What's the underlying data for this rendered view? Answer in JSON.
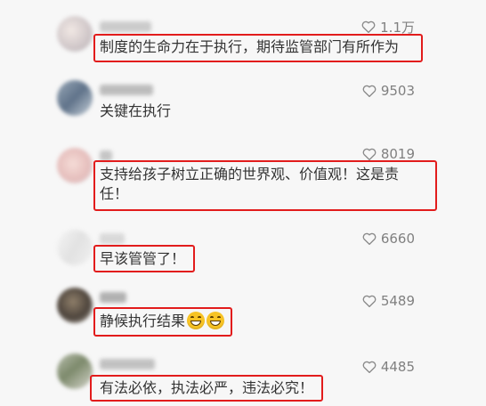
{
  "comments": [
    {
      "text": "制度的生命力在于执行，期待监管部门有所作为",
      "likes": "1.1万",
      "username": "jiasong"
    },
    {
      "text": "关键在执行",
      "likes": "9503",
      "username": ""
    },
    {
      "text_line1": "支持给孩子树立正确的世界观、价值观！这是责",
      "text_line2": "任！",
      "likes": "8019",
      "username": ""
    },
    {
      "text": "早该管管了！",
      "likes": "6660",
      "username": ""
    },
    {
      "text": "静候执行结果",
      "emoji": "grinning-face-emoji",
      "likes": "5489",
      "username": ""
    },
    {
      "text": "有法必依，执法必严，违法必究！",
      "likes": "4485",
      "username": ""
    }
  ],
  "colors": {
    "highlight": "#e21c1c",
    "like_text": "#808080",
    "body_text": "#333333",
    "background": "#f7f7f7"
  },
  "icons": {
    "like": "heart-outline-icon"
  }
}
